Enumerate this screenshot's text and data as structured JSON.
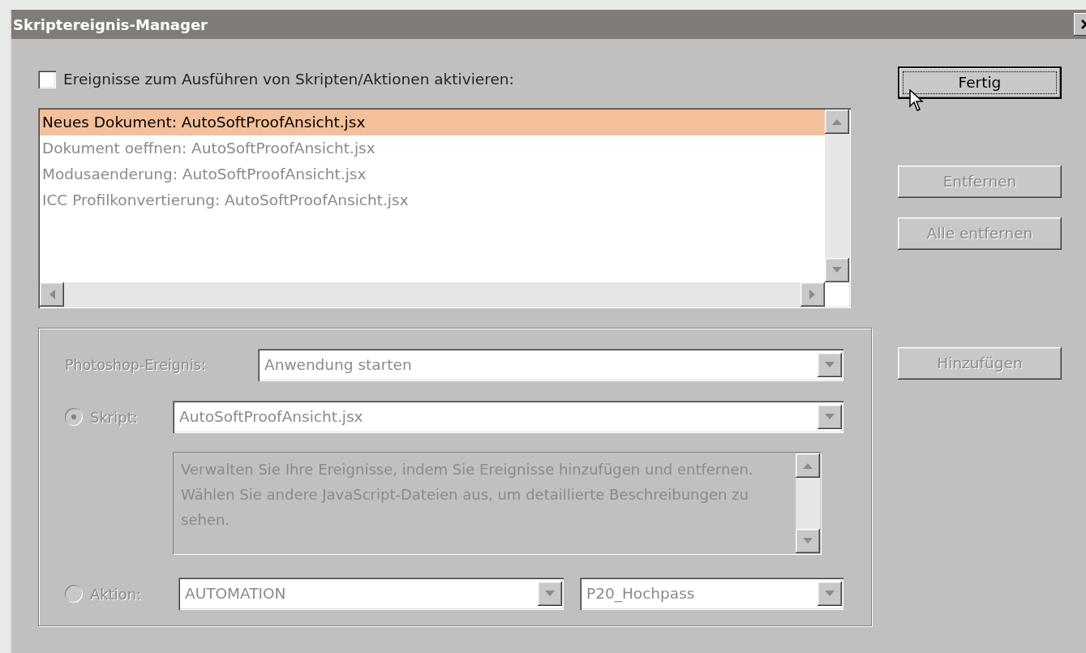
{
  "window": {
    "title": "Skriptereignis-Manager"
  },
  "enable_checkbox": {
    "label": "Ereignisse zum Ausführen von Skripten/Aktionen aktivieren:",
    "checked": false
  },
  "events": [
    {
      "label": "Neues Dokument: AutoSoftProofAnsicht.jsx",
      "selected": true
    },
    {
      "label": "Dokument oeffnen: AutoSoftProofAnsicht.jsx",
      "selected": false
    },
    {
      "label": "Modusaenderung: AutoSoftProofAnsicht.jsx",
      "selected": false
    },
    {
      "label": "ICC Profilkonvertierung: AutoSoftProofAnsicht.jsx",
      "selected": false
    }
  ],
  "buttons": [
    {
      "label": "Fertig",
      "disabled": false,
      "focused": true
    },
    {
      "label": "Entfernen",
      "disabled": true,
      "focused": false
    },
    {
      "label": "Alle entfernen",
      "disabled": true,
      "focused": false
    }
  ],
  "add_button": {
    "label": "Hinzufügen",
    "disabled": true
  },
  "event_form": {
    "disabled": true,
    "event_label": "Photoshop-Ereignis:",
    "event_value": "Anwendung starten",
    "options": [
      {
        "kind": "script",
        "label": "Skript:",
        "selected": true,
        "value": "AutoSoftProofAnsicht.jsx",
        "description": "Verwalten Sie Ihre Ereignisse, indem Sie Ereignisse hinzufügen und entfernen. Wählen Sie andere JavaScript-Dateien aus, um detaillierte Beschreibungen zu sehen."
      },
      {
        "kind": "action",
        "label": "Aktion:",
        "selected": false,
        "set": "AUTOMATION",
        "value": "P20_Hochpass"
      }
    ]
  }
}
